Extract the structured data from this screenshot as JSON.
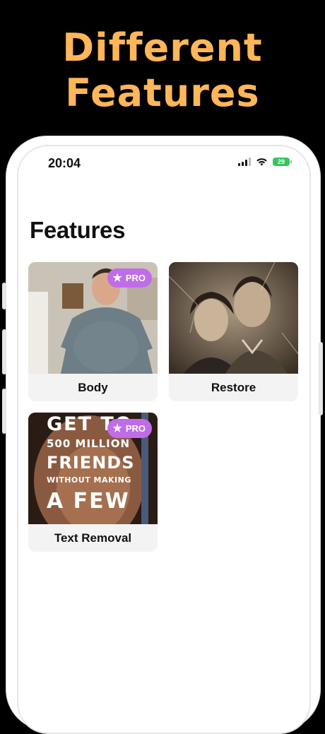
{
  "promo": {
    "headline_line1": "Different",
    "headline_line2": "Features",
    "headline_color": "#FFB658"
  },
  "status_bar": {
    "time": "20:04",
    "battery": "29",
    "battery_color": "#34C759",
    "icons": [
      "signal-icon",
      "wifi-icon",
      "battery-icon"
    ]
  },
  "page": {
    "title": "Features"
  },
  "cards": [
    {
      "label": "Body",
      "pro": true,
      "pro_label": "PRO"
    },
    {
      "label": "Restore",
      "pro": false
    },
    {
      "label": "Text Removal",
      "pro": true,
      "pro_label": "PRO"
    }
  ],
  "text_removal_poster": {
    "line1": "GET TO",
    "line2": "500 MILLION",
    "line3": "FRIENDS",
    "line4": "WITHOUT MAKING",
    "line5": "A FEW"
  },
  "accent_pro_color": "#C06CE8"
}
